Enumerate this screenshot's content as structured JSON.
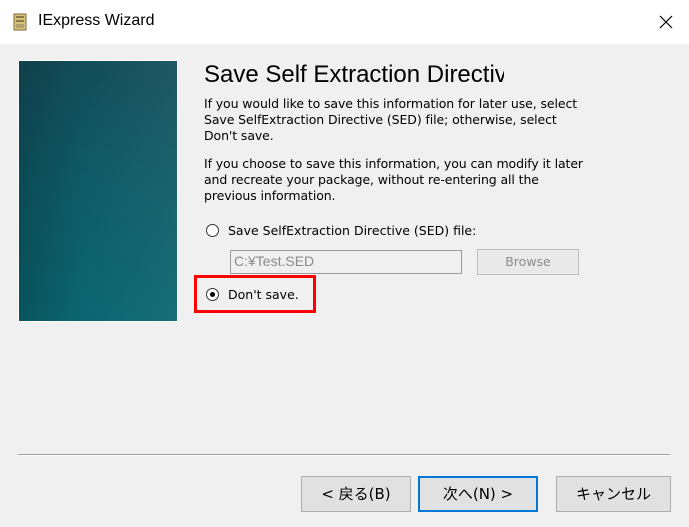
{
  "window": {
    "title": "IExpress Wizard"
  },
  "page": {
    "heading": "Save Self Extraction Directive",
    "paragraph1": "If you would like to save this information for later use, select Save SelfExtraction Directive (SED) file; otherwise, select Don't save.",
    "paragraph2": "If you choose to save this information, you can modify it later and recreate your package, without re-entering all the previous information."
  },
  "options": {
    "save_sed_label": "Save SelfExtraction Directive (SED) file:",
    "save_sed_checked": false,
    "dont_save_label": "Don't save.",
    "dont_save_checked": true
  },
  "sed_path": {
    "value": "C:¥Test.SED"
  },
  "browse_label": "Browse",
  "footer": {
    "back_label": "< 戻る(B)",
    "next_label": "次へ(N) >",
    "cancel_label": "キャンセル"
  },
  "colors": {
    "highlight": "#ff0000",
    "default_button_border": "#0078d7",
    "banner": "#0e5a66"
  },
  "icons": {
    "app": "iexpress-app-icon",
    "close": "close-icon"
  }
}
